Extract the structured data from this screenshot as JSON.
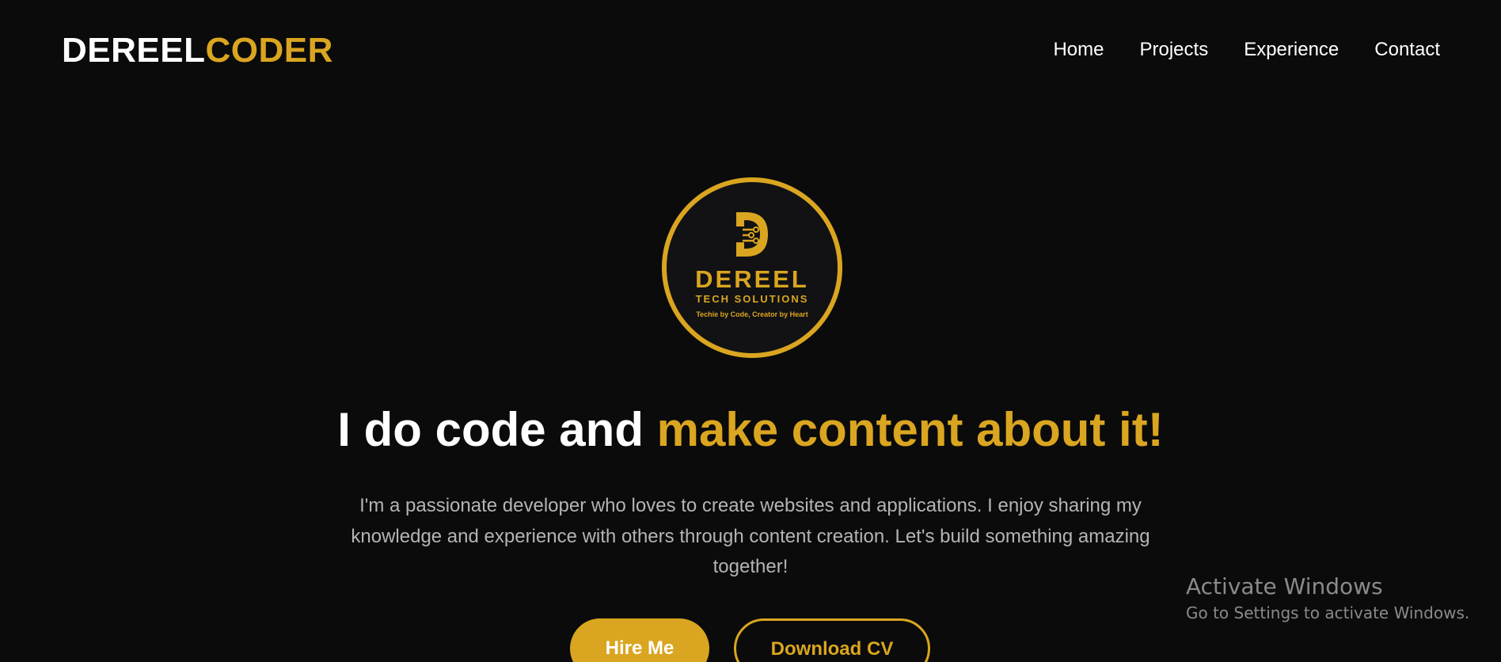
{
  "header": {
    "brand_part1": "DEREEL",
    "brand_part2": "CODER",
    "nav": [
      {
        "label": "Home"
      },
      {
        "label": "Projects"
      },
      {
        "label": "Experience"
      },
      {
        "label": "Contact"
      }
    ]
  },
  "hero": {
    "logo": {
      "name": "DEREEL",
      "subtitle": "TECH SOLUTIONS",
      "tagline": "Techie by Code, Creator by Heart"
    },
    "headline_white": "I do code and ",
    "headline_gold": "make content about it!",
    "intro": "I'm a passionate developer who loves to create websites and applications. I enjoy sharing my knowledge and experience with others through content creation. Let's build something amazing together!",
    "hire_button": "Hire Me",
    "cv_button": "Download CV"
  },
  "watermark": {
    "title": "Activate Windows",
    "subtitle": "Go to Settings to activate Windows."
  },
  "colors": {
    "background": "#0b0b0b",
    "accent": "#daa520",
    "text": "#ffffff",
    "muted": "#b4b4b4"
  }
}
